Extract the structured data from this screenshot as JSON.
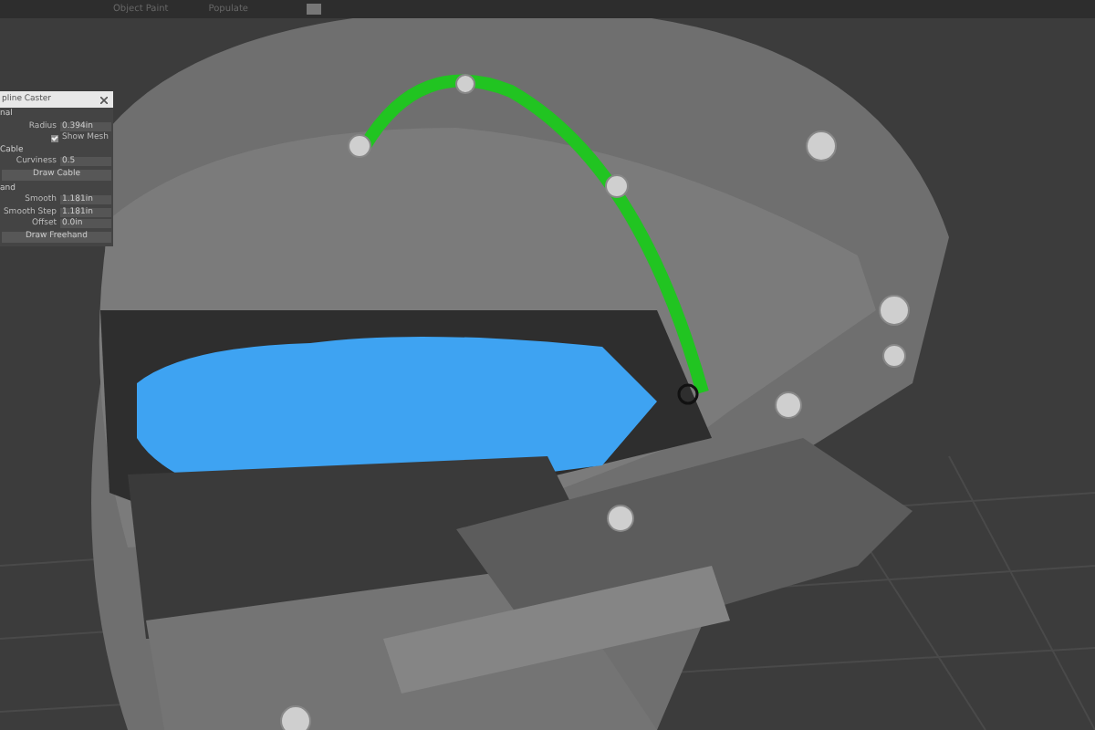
{
  "menu_bar": {
    "items": [
      "Object Paint",
      "Populate"
    ]
  },
  "panel": {
    "title": "pline Caster",
    "rows": [
      {
        "kind": "section",
        "label": "nal"
      },
      {
        "kind": "field",
        "label": "Radius",
        "value": "0.394in"
      },
      {
        "kind": "checkbox",
        "label": "Show Mesh",
        "checked": true
      },
      {
        "kind": "section",
        "label": "Cable"
      },
      {
        "kind": "field",
        "label": "Curviness",
        "value": "0.5"
      },
      {
        "kind": "button",
        "label": "Draw Cable"
      },
      {
        "kind": "section",
        "label": "and"
      },
      {
        "kind": "field",
        "label": "Smooth",
        "value": "1.181in"
      },
      {
        "kind": "field",
        "label": "Smooth Step",
        "value": "1.181in"
      },
      {
        "kind": "field",
        "label": "Offset",
        "value": "0.0in"
      },
      {
        "kind": "button",
        "label": "Draw Freehand"
      }
    ]
  }
}
